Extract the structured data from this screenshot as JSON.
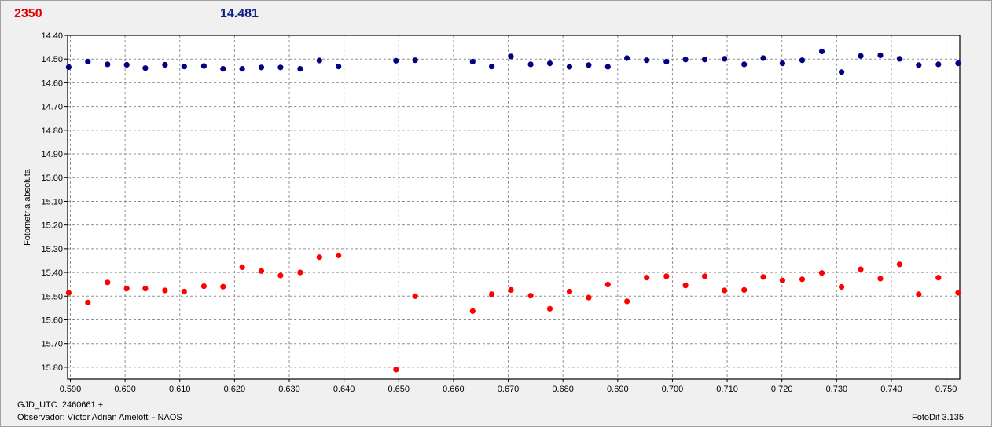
{
  "header": {
    "value_red": "2350",
    "value_blue": "14.481",
    "color_red": "#ff0000",
    "color_blue": "#000080"
  },
  "footer": {
    "gjd": "GJD_UTC: 2460661 +",
    "observer": "Observador: Víctor Adrián Amelotti - NAOS",
    "software": "FotoDif 3.135"
  },
  "chart_data": {
    "type": "scatter",
    "ylabel": "Fotometría absoluta",
    "xlabel": "",
    "xlim": [
      0.5895,
      0.7525
    ],
    "ylim": [
      14.4,
      15.85
    ],
    "y_inverted": true,
    "grid": true,
    "x_ticks": [
      "0.590",
      "0.600",
      "0.610",
      "0.620",
      "0.630",
      "0.640",
      "0.650",
      "0.660",
      "0.670",
      "0.680",
      "0.690",
      "0.700",
      "0.710",
      "0.720",
      "0.730",
      "0.740",
      "0.750"
    ],
    "y_ticks": [
      "14.40",
      "14.50",
      "14.60",
      "14.70",
      "14.80",
      "14.90",
      "15.00",
      "15.10",
      "15.20",
      "15.30",
      "15.40",
      "15.50",
      "15.60",
      "15.70",
      "15.80"
    ],
    "series": [
      {
        "color": "#000080",
        "points": [
          [
            0.5897,
            14.534
          ],
          [
            0.5932,
            14.511
          ],
          [
            0.5968,
            14.522
          ],
          [
            0.6003,
            14.524
          ],
          [
            0.6037,
            14.538
          ],
          [
            0.6073,
            14.524
          ],
          [
            0.6108,
            14.531
          ],
          [
            0.6144,
            14.529
          ],
          [
            0.6179,
            14.541
          ],
          [
            0.6214,
            14.541
          ],
          [
            0.6249,
            14.535
          ],
          [
            0.6284,
            14.535
          ],
          [
            0.632,
            14.541
          ],
          [
            0.6355,
            14.506
          ],
          [
            0.639,
            14.531
          ],
          [
            0.6495,
            14.507
          ],
          [
            0.653,
            14.505
          ],
          [
            0.6635,
            14.511
          ],
          [
            0.667,
            14.531
          ],
          [
            0.6705,
            14.489
          ],
          [
            0.6741,
            14.522
          ],
          [
            0.6776,
            14.518
          ],
          [
            0.6812,
            14.532
          ],
          [
            0.6847,
            14.525
          ],
          [
            0.6882,
            14.532
          ],
          [
            0.6917,
            14.496
          ],
          [
            0.6953,
            14.505
          ],
          [
            0.6989,
            14.511
          ],
          [
            0.7024,
            14.502
          ],
          [
            0.7059,
            14.502
          ],
          [
            0.7095,
            14.499
          ],
          [
            0.7131,
            14.522
          ],
          [
            0.7166,
            14.496
          ],
          [
            0.7201,
            14.518
          ],
          [
            0.7237,
            14.505
          ],
          [
            0.7273,
            14.468
          ],
          [
            0.7309,
            14.555
          ],
          [
            0.7344,
            14.487
          ],
          [
            0.738,
            14.484
          ],
          [
            0.7415,
            14.499
          ],
          [
            0.745,
            14.525
          ],
          [
            0.7486,
            14.522
          ],
          [
            0.7522,
            14.518
          ]
        ]
      },
      {
        "color": "#ff0000",
        "points": [
          [
            0.5897,
            15.486
          ],
          [
            0.5932,
            15.527
          ],
          [
            0.5968,
            15.442
          ],
          [
            0.6003,
            15.468
          ],
          [
            0.6037,
            15.468
          ],
          [
            0.6073,
            15.476
          ],
          [
            0.6108,
            15.481
          ],
          [
            0.6144,
            15.458
          ],
          [
            0.6179,
            15.46
          ],
          [
            0.6214,
            15.378
          ],
          [
            0.6249,
            15.394
          ],
          [
            0.6284,
            15.413
          ],
          [
            0.632,
            15.4
          ],
          [
            0.6355,
            15.336
          ],
          [
            0.639,
            15.328
          ],
          [
            0.6495,
            15.81
          ],
          [
            0.653,
            15.5
          ],
          [
            0.6635,
            15.563
          ],
          [
            0.667,
            15.492
          ],
          [
            0.6705,
            15.474
          ],
          [
            0.6741,
            15.498
          ],
          [
            0.6776,
            15.553
          ],
          [
            0.6812,
            15.481
          ],
          [
            0.6847,
            15.506
          ],
          [
            0.6882,
            15.451
          ],
          [
            0.6917,
            15.522
          ],
          [
            0.6953,
            15.422
          ],
          [
            0.6989,
            15.416
          ],
          [
            0.7024,
            15.455
          ],
          [
            0.7059,
            15.416
          ],
          [
            0.7095,
            15.476
          ],
          [
            0.7131,
            15.474
          ],
          [
            0.7166,
            15.419
          ],
          [
            0.7201,
            15.434
          ],
          [
            0.7237,
            15.429
          ],
          [
            0.7273,
            15.402
          ],
          [
            0.7309,
            15.461
          ],
          [
            0.7344,
            15.387
          ],
          [
            0.738,
            15.426
          ],
          [
            0.7415,
            15.366
          ],
          [
            0.745,
            15.492
          ],
          [
            0.7486,
            15.422
          ],
          [
            0.7522,
            15.486
          ]
        ]
      }
    ]
  }
}
